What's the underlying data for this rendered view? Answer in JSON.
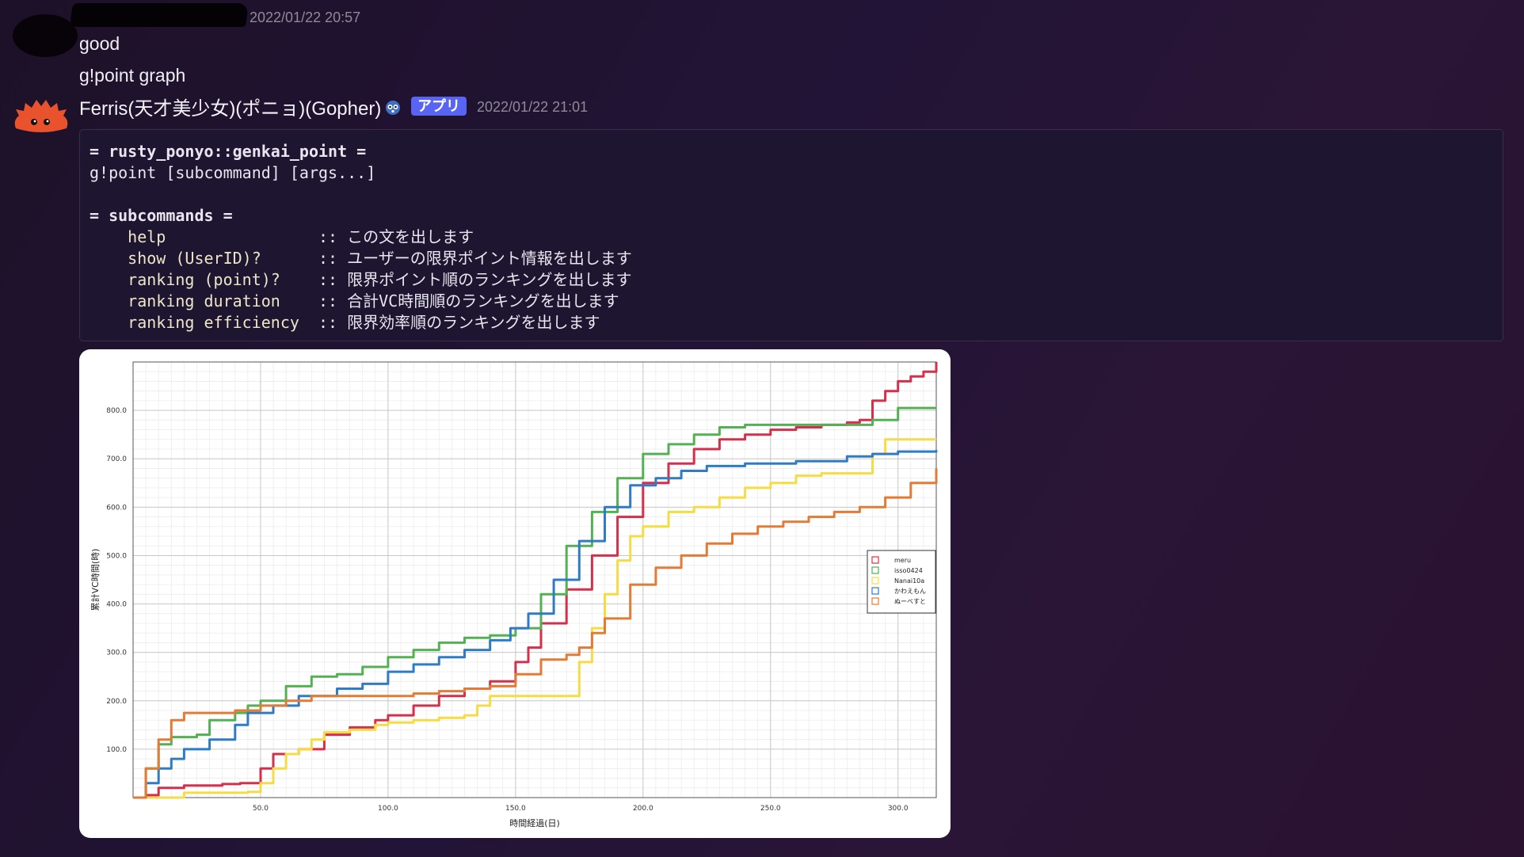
{
  "messages": {
    "first": {
      "timestamp": "2022/01/22 20:57",
      "lines": [
        "good",
        "g!point graph"
      ]
    },
    "bot": {
      "name": "Ferris(天才美少女)(ポニョ)(Gopher)",
      "badge": "アプリ",
      "timestamp": "2022/01/22 21:01",
      "code": {
        "title": "= rusty_ponyo::genkai_point =",
        "usage": "g!point [subcommand] [args...]",
        "subtitle": "= subcommands =",
        "commands": [
          {
            "cmd": "help",
            "desc": ":: この文を出します"
          },
          {
            "cmd": "show (UserID)?",
            "desc": ":: ユーザーの限界ポイント情報を出します"
          },
          {
            "cmd": "ranking (point)?",
            "desc": ":: 限界ポイント順のランキングを出します"
          },
          {
            "cmd": "ranking duration",
            "desc": ":: 合計VC時間順のランキングを出します"
          },
          {
            "cmd": "ranking efficiency",
            "desc": ":: 限界効率順のランキングを出します"
          }
        ]
      }
    }
  },
  "chart_data": {
    "type": "line",
    "xlabel": "時間経過(日)",
    "ylabel": "累計VC時間(時)",
    "xlim": [
      0,
      315
    ],
    "ylim": [
      0,
      900
    ],
    "xticks": [
      "50.0",
      "100.0",
      "150.0",
      "200.0",
      "250.0",
      "300.0"
    ],
    "yticks": [
      "100.0",
      "200.0",
      "300.0",
      "400.0",
      "500.0",
      "600.0",
      "700.0",
      "800.0"
    ],
    "grid": true,
    "legend_position": "right",
    "series": [
      {
        "name": "meru",
        "color": "#d62f4b",
        "points": [
          [
            0,
            0
          ],
          [
            5,
            5
          ],
          [
            10,
            20
          ],
          [
            20,
            25
          ],
          [
            35,
            28
          ],
          [
            42,
            30
          ],
          [
            50,
            60
          ],
          [
            55,
            90
          ],
          [
            65,
            100
          ],
          [
            75,
            130
          ],
          [
            85,
            145
          ],
          [
            95,
            160
          ],
          [
            100,
            170
          ],
          [
            110,
            190
          ],
          [
            120,
            210
          ],
          [
            130,
            225
          ],
          [
            140,
            240
          ],
          [
            150,
            280
          ],
          [
            155,
            310
          ],
          [
            160,
            360
          ],
          [
            170,
            430
          ],
          [
            180,
            500
          ],
          [
            190,
            580
          ],
          [
            200,
            650
          ],
          [
            210,
            690
          ],
          [
            220,
            720
          ],
          [
            230,
            740
          ],
          [
            240,
            750
          ],
          [
            250,
            760
          ],
          [
            260,
            765
          ],
          [
            270,
            770
          ],
          [
            280,
            775
          ],
          [
            285,
            780
          ],
          [
            290,
            820
          ],
          [
            295,
            840
          ],
          [
            300,
            860
          ],
          [
            305,
            870
          ],
          [
            310,
            880
          ],
          [
            315,
            900
          ]
        ]
      },
      {
        "name": "isso0424",
        "color": "#54b153",
        "points": [
          [
            0,
            0
          ],
          [
            5,
            60
          ],
          [
            10,
            110
          ],
          [
            15,
            125
          ],
          [
            25,
            130
          ],
          [
            30,
            160
          ],
          [
            40,
            175
          ],
          [
            45,
            190
          ],
          [
            50,
            200
          ],
          [
            60,
            230
          ],
          [
            70,
            250
          ],
          [
            80,
            255
          ],
          [
            90,
            270
          ],
          [
            100,
            290
          ],
          [
            110,
            305
          ],
          [
            120,
            320
          ],
          [
            130,
            330
          ],
          [
            140,
            335
          ],
          [
            150,
            350
          ],
          [
            160,
            420
          ],
          [
            170,
            520
          ],
          [
            180,
            590
          ],
          [
            190,
            660
          ],
          [
            200,
            710
          ],
          [
            210,
            730
          ],
          [
            220,
            750
          ],
          [
            230,
            765
          ],
          [
            240,
            770
          ],
          [
            250,
            770
          ],
          [
            260,
            770
          ],
          [
            270,
            770
          ],
          [
            280,
            770
          ],
          [
            290,
            780
          ],
          [
            300,
            805
          ],
          [
            315,
            805
          ]
        ]
      },
      {
        "name": "Nanai10a",
        "color": "#f5dc45",
        "points": [
          [
            0,
            0
          ],
          [
            15,
            0
          ],
          [
            20,
            10
          ],
          [
            30,
            10
          ],
          [
            45,
            12
          ],
          [
            50,
            30
          ],
          [
            55,
            60
          ],
          [
            60,
            90
          ],
          [
            65,
            100
          ],
          [
            70,
            120
          ],
          [
            75,
            135
          ],
          [
            85,
            140
          ],
          [
            95,
            150
          ],
          [
            100,
            155
          ],
          [
            110,
            160
          ],
          [
            120,
            165
          ],
          [
            130,
            170
          ],
          [
            135,
            190
          ],
          [
            140,
            210
          ],
          [
            150,
            210
          ],
          [
            160,
            210
          ],
          [
            170,
            210
          ],
          [
            175,
            280
          ],
          [
            180,
            350
          ],
          [
            185,
            420
          ],
          [
            190,
            490
          ],
          [
            195,
            540
          ],
          [
            200,
            560
          ],
          [
            210,
            590
          ],
          [
            220,
            600
          ],
          [
            230,
            620
          ],
          [
            240,
            640
          ],
          [
            250,
            650
          ],
          [
            260,
            665
          ],
          [
            270,
            670
          ],
          [
            285,
            670
          ],
          [
            290,
            710
          ],
          [
            295,
            740
          ],
          [
            315,
            740
          ]
        ]
      },
      {
        "name": "かわえもん",
        "color": "#2f7bc4",
        "points": [
          [
            0,
            0
          ],
          [
            5,
            30
          ],
          [
            10,
            60
          ],
          [
            15,
            80
          ],
          [
            20,
            100
          ],
          [
            30,
            120
          ],
          [
            40,
            150
          ],
          [
            45,
            175
          ],
          [
            55,
            190
          ],
          [
            65,
            210
          ],
          [
            80,
            225
          ],
          [
            90,
            235
          ],
          [
            100,
            260
          ],
          [
            110,
            275
          ],
          [
            120,
            290
          ],
          [
            130,
            305
          ],
          [
            140,
            325
          ],
          [
            148,
            350
          ],
          [
            155,
            380
          ],
          [
            165,
            450
          ],
          [
            175,
            530
          ],
          [
            185,
            600
          ],
          [
            195,
            645
          ],
          [
            205,
            660
          ],
          [
            215,
            675
          ],
          [
            225,
            685
          ],
          [
            240,
            690
          ],
          [
            260,
            695
          ],
          [
            280,
            705
          ],
          [
            290,
            710
          ],
          [
            300,
            715
          ],
          [
            315,
            718
          ]
        ]
      },
      {
        "name": "ぬーべすと",
        "color": "#e17b36",
        "points": [
          [
            0,
            0
          ],
          [
            5,
            60
          ],
          [
            10,
            120
          ],
          [
            15,
            160
          ],
          [
            20,
            175
          ],
          [
            30,
            175
          ],
          [
            40,
            180
          ],
          [
            50,
            190
          ],
          [
            60,
            200
          ],
          [
            70,
            210
          ],
          [
            80,
            210
          ],
          [
            95,
            210
          ],
          [
            110,
            215
          ],
          [
            120,
            220
          ],
          [
            130,
            225
          ],
          [
            140,
            230
          ],
          [
            150,
            255
          ],
          [
            160,
            285
          ],
          [
            170,
            295
          ],
          [
            175,
            310
          ],
          [
            180,
            340
          ],
          [
            185,
            370
          ],
          [
            195,
            440
          ],
          [
            205,
            475
          ],
          [
            215,
            500
          ],
          [
            225,
            525
          ],
          [
            235,
            545
          ],
          [
            245,
            560
          ],
          [
            255,
            570
          ],
          [
            265,
            580
          ],
          [
            275,
            590
          ],
          [
            285,
            600
          ],
          [
            295,
            620
          ],
          [
            305,
            650
          ],
          [
            315,
            680
          ]
        ]
      }
    ]
  }
}
